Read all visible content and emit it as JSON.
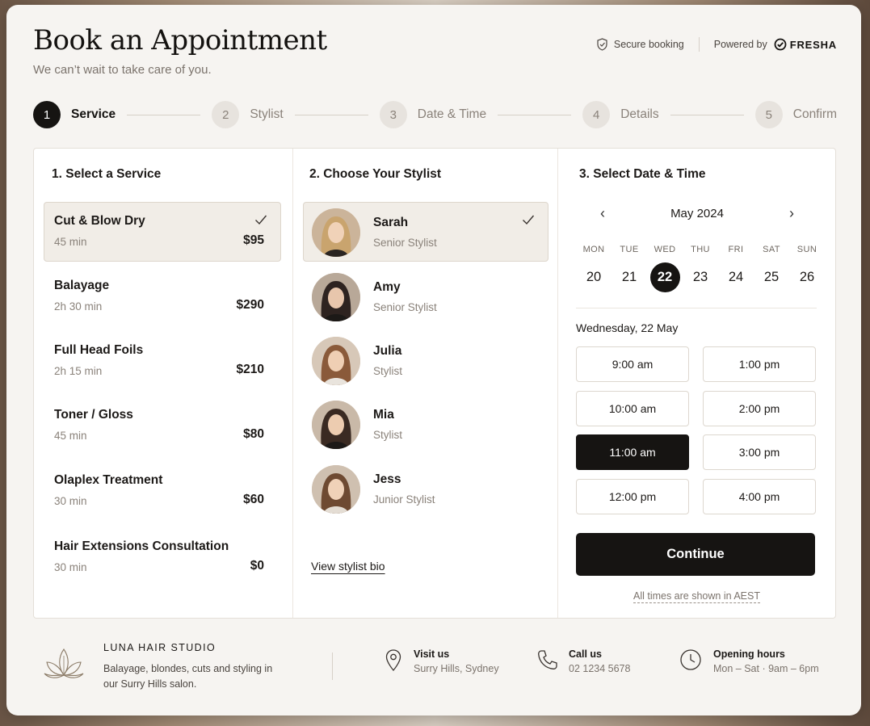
{
  "header": {
    "title": "Book an Appointment",
    "subtitle": "We can’t wait to take care of you.",
    "secure_label": "Secure booking",
    "powered_label": "Powered by",
    "brand": "FRESHA"
  },
  "steps": [
    {
      "num": "1",
      "label": "Service",
      "active": true
    },
    {
      "num": "2",
      "label": "Stylist",
      "active": false
    },
    {
      "num": "3",
      "label": "Date & Time",
      "active": false
    },
    {
      "num": "4",
      "label": "Details",
      "active": false
    },
    {
      "num": "5",
      "label": "Confirm",
      "active": false
    }
  ],
  "services": {
    "title": "1. Select a Service",
    "items": [
      {
        "name": "Cut & Blow Dry",
        "duration": "45 min",
        "price": "$95",
        "selected": true
      },
      {
        "name": "Balayage",
        "duration": "2h 30 min",
        "price": "$290",
        "selected": false
      },
      {
        "name": "Full Head Foils",
        "duration": "2h 15 min",
        "price": "$210",
        "selected": false
      },
      {
        "name": "Toner / Gloss",
        "duration": "45 min",
        "price": "$80",
        "selected": false
      },
      {
        "name": "Olaplex Treatment",
        "duration": "30 min",
        "price": "$60",
        "selected": false
      },
      {
        "name": "Hair Extensions Consultation",
        "duration": "30 min",
        "price": "$0",
        "selected": false
      }
    ]
  },
  "stylists": {
    "title": "2. Choose Your Stylist",
    "items": [
      {
        "name": "Sarah",
        "role": "Senior Stylist",
        "selected": true
      },
      {
        "name": "Amy",
        "role": "Senior Stylist",
        "selected": false
      },
      {
        "name": "Julia",
        "role": "Stylist",
        "selected": false
      },
      {
        "name": "Mia",
        "role": "Stylist",
        "selected": false
      },
      {
        "name": "Jess",
        "role": "Junior Stylist",
        "selected": false
      }
    ],
    "bio_link": "View stylist bio"
  },
  "datetime": {
    "title": "3. Select Date & Time",
    "month": "May 2024",
    "weekdays": [
      "MON",
      "TUE",
      "WED",
      "THU",
      "FRI",
      "SAT",
      "SUN"
    ],
    "days": [
      "20",
      "21",
      "22",
      "23",
      "24",
      "25",
      "26"
    ],
    "selected_day": "22",
    "date_label": "Wednesday, 22 May",
    "slots_left": [
      "9:00 am",
      "10:00 am",
      "11:00 am",
      "12:00 pm"
    ],
    "slots_right": [
      "1:00 pm",
      "2:00 pm",
      "3:00 pm",
      "4:00 pm"
    ],
    "selected_slot": "11:00 am",
    "continue_label": "Continue",
    "timezone_note": "All times are shown in AEST"
  },
  "footer": {
    "studio_name": "LUNA HAIR STUDIO",
    "studio_desc": "Balayage, blondes, cuts and styling in our Surry Hills salon.",
    "visit_title": "Visit us",
    "visit_value": "Surry Hills, Sydney",
    "call_title": "Call us",
    "call_value": "02 1234 5678",
    "hours_title": "Opening hours",
    "hours_value": "Mon – Sat · 9am – 6pm"
  },
  "colors": {
    "accent": "#161412",
    "selected_bg": "#f1ede7",
    "muted_text": "#8a827a",
    "card_bg": "#f6f4f1"
  }
}
